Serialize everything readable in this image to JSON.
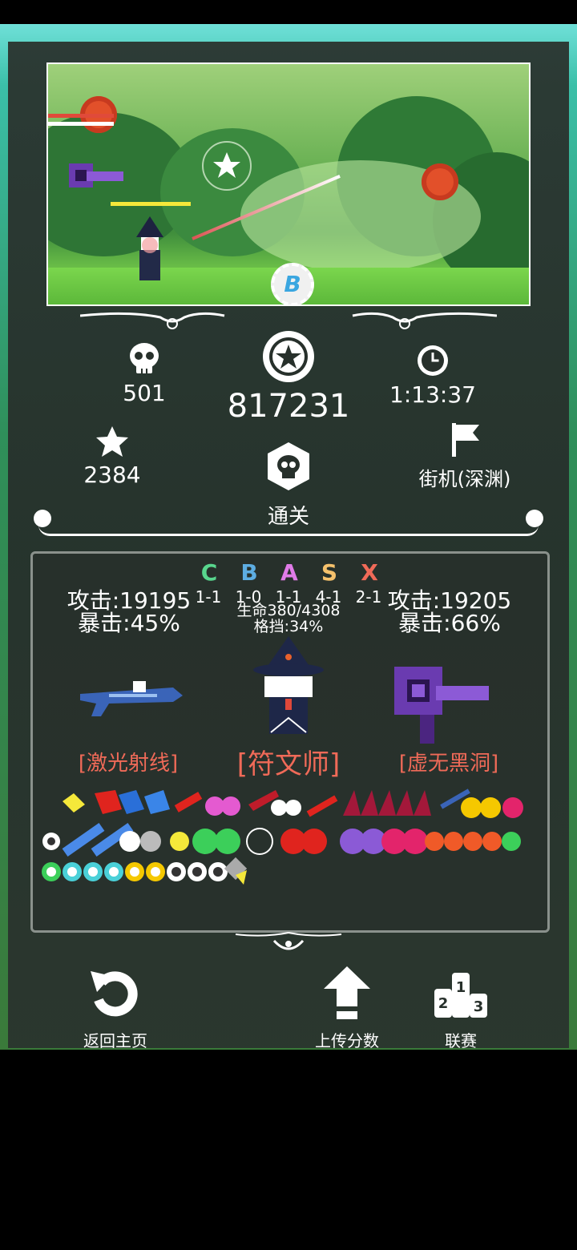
{
  "stats": {
    "kills": "501",
    "score": "817231",
    "time": "1:13:37",
    "stars": "2384",
    "result": "通关",
    "mode": "街机(深渊)"
  },
  "ranks": [
    {
      "letter": "C",
      "value": "1-1",
      "color": "#58d68d"
    },
    {
      "letter": "B",
      "value": "1-0",
      "color": "#5dade2"
    },
    {
      "letter": "A",
      "value": "1-1",
      "color": "#e07be8"
    },
    {
      "letter": "S",
      "value": "4-1",
      "color": "#f5c16c"
    },
    {
      "letter": "X",
      "value": "2-1",
      "color": "#f06a58"
    }
  ],
  "left_weapon": {
    "attack": "攻击:19195",
    "crit": "暴击:45%",
    "name": "[激光射线]"
  },
  "character": {
    "hp": "生命380/4308",
    "block": "格挡:34%",
    "name": "[符文师]"
  },
  "right_weapon": {
    "attack": "攻击:19205",
    "crit": "暴击:66%",
    "name": "[虚无黑洞]"
  },
  "buttons": {
    "home": "返回主页",
    "upload": "上传分数",
    "league": "联赛"
  },
  "icons": {
    "kills": "skull-icon",
    "score": "star-medal-icon",
    "time": "clock-icon",
    "stars": "star-icon",
    "result": "skull-badge-icon",
    "mode": "flag-icon",
    "home": "return-arrow-icon",
    "upload": "upload-arrow-icon",
    "league": "podium-icon"
  }
}
